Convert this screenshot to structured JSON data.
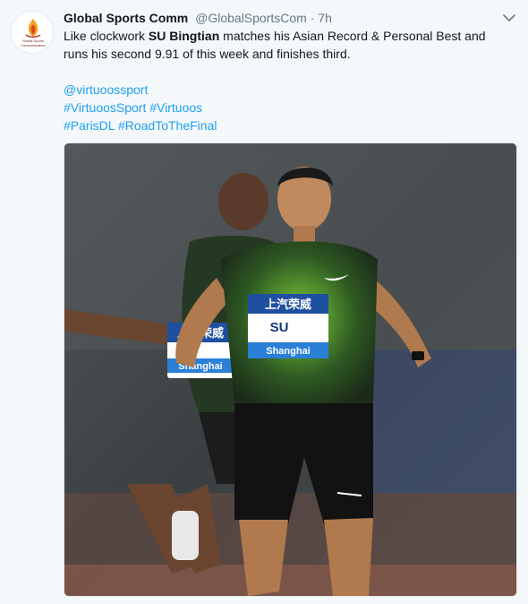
{
  "account": {
    "display_name": "Global Sports Comm",
    "handle": "@GlobalSportsCom",
    "separator": "·",
    "timestamp": "7h",
    "avatar_text": "Global Sports Communication"
  },
  "tweet": {
    "text_before": "Like clockwork ",
    "text_bold": "SU Bingtian",
    "text_after": " matches his Asian Record & Personal Best and runs his second 9.91 of this week and finishes third.",
    "mention": "@virtuoossport",
    "hashtags_line1": "#VirtuoosSport #Virtuoos",
    "hashtags_line2": "#ParisDL #RoadToTheFinal"
  },
  "photo": {
    "bib_main_sponsor": "上汽荣威",
    "bib_main_name": "SU",
    "bib_main_city": "Shanghai",
    "bib_back_sponsor": "上汽荣威",
    "bib_back_city": "Shanghai"
  },
  "colors": {
    "link": "#1da1f2",
    "muted": "#657786",
    "background": "#f5f8fa"
  },
  "icons": {
    "caret": "chevron-down-icon",
    "avatar_logo": "flame-logo-icon"
  }
}
